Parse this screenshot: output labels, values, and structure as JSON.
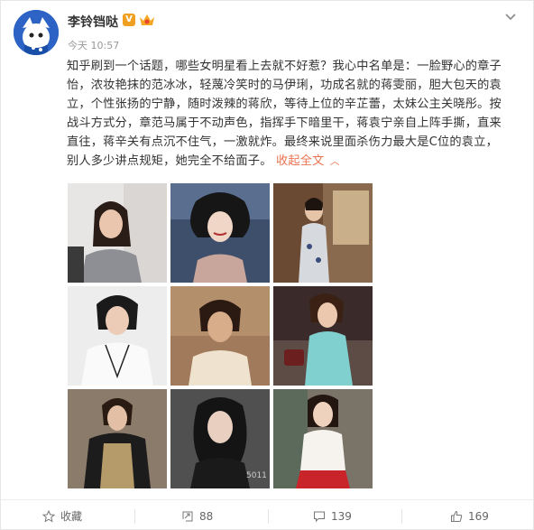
{
  "post": {
    "username": "李铃铛哒",
    "verified_badge": "V",
    "timestamp": "今天 10:57",
    "body": "知乎刷到一个话题，哪些女明星看上去就不好惹？我心中名单是：一脸野心的章子怡，浓妆艳抹的范冰冰，轻蔑冷笑时的马伊琍，功成名就的蒋雯丽，胆大包天的袁立，个性张扬的宁静，随时泼辣的蒋欣，等待上位的辛芷蕾，太妹公主关晓彤。按战斗方式分，章范马属于不动声色，指挥手下暗里干，蒋袁宁亲自上阵手撕，直来直往，蒋辛关有点沉不住气，一激就炸。最终来说里面杀伤力最大是C位的袁立，别人多少讲点规矩，她完全不给面子。",
    "collapse_label": "收起全文",
    "icons": {
      "avatar": "avatar-icon",
      "crown": "crown-badge-icon",
      "menu": "chevron-down-icon"
    }
  },
  "photos": [
    {
      "name": "photo-1"
    },
    {
      "name": "photo-2"
    },
    {
      "name": "photo-3"
    },
    {
      "name": "photo-4"
    },
    {
      "name": "photo-5"
    },
    {
      "name": "photo-6"
    },
    {
      "name": "photo-7"
    },
    {
      "name": "photo-8"
    },
    {
      "name": "photo-9"
    }
  ],
  "actions": {
    "favorite_label": "收藏",
    "repost_count": "88",
    "comment_count": "139",
    "like_count": "169"
  },
  "colors": {
    "link": "#eb7350",
    "avatar_bg": "#2c63c4",
    "badge": "#f0a020"
  }
}
